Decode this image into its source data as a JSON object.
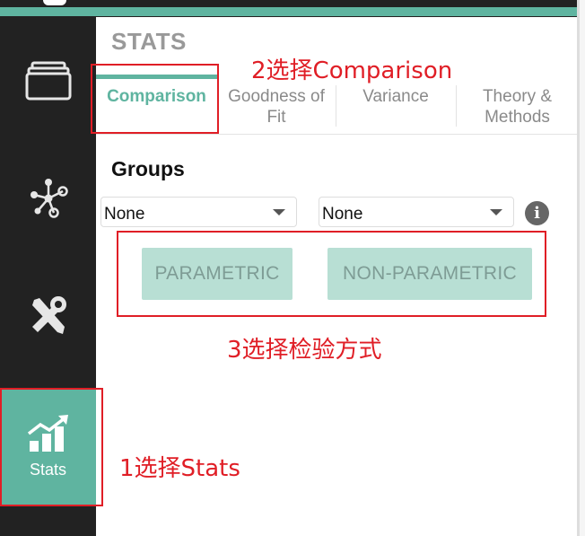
{
  "panel": {
    "title": "STATS",
    "tabs": [
      {
        "label": "Comparison",
        "active": true
      },
      {
        "label": "Goodness of\nFit",
        "active": false
      },
      {
        "label": "Variance",
        "active": false
      },
      {
        "label": "Theory &\nMethods",
        "active": false
      }
    ],
    "groups_title": "Groups",
    "selects": [
      {
        "value": "None"
      },
      {
        "value": "None"
      }
    ],
    "info_glyph": "i",
    "buttons": {
      "parametric": "PARAMETRIC",
      "non_parametric": "NON-PARAMETRIC"
    }
  },
  "rail": {
    "items": [
      {
        "icon": "window-stack-icon"
      },
      {
        "icon": "network-nodes-icon"
      },
      {
        "icon": "wrench-screwdriver-icon"
      },
      {
        "icon": "chart-up-icon",
        "label": "Stats",
        "active": true
      }
    ]
  },
  "annotations": {
    "step1": "1选择Stats",
    "step2": "2选择Comparison",
    "step3": "3选择检验方式"
  },
  "colors": {
    "accent": "#5fb4a0",
    "rail_bg": "#222222",
    "button_bg": "#b8dfd4",
    "annotation_red": "#e01e26"
  }
}
